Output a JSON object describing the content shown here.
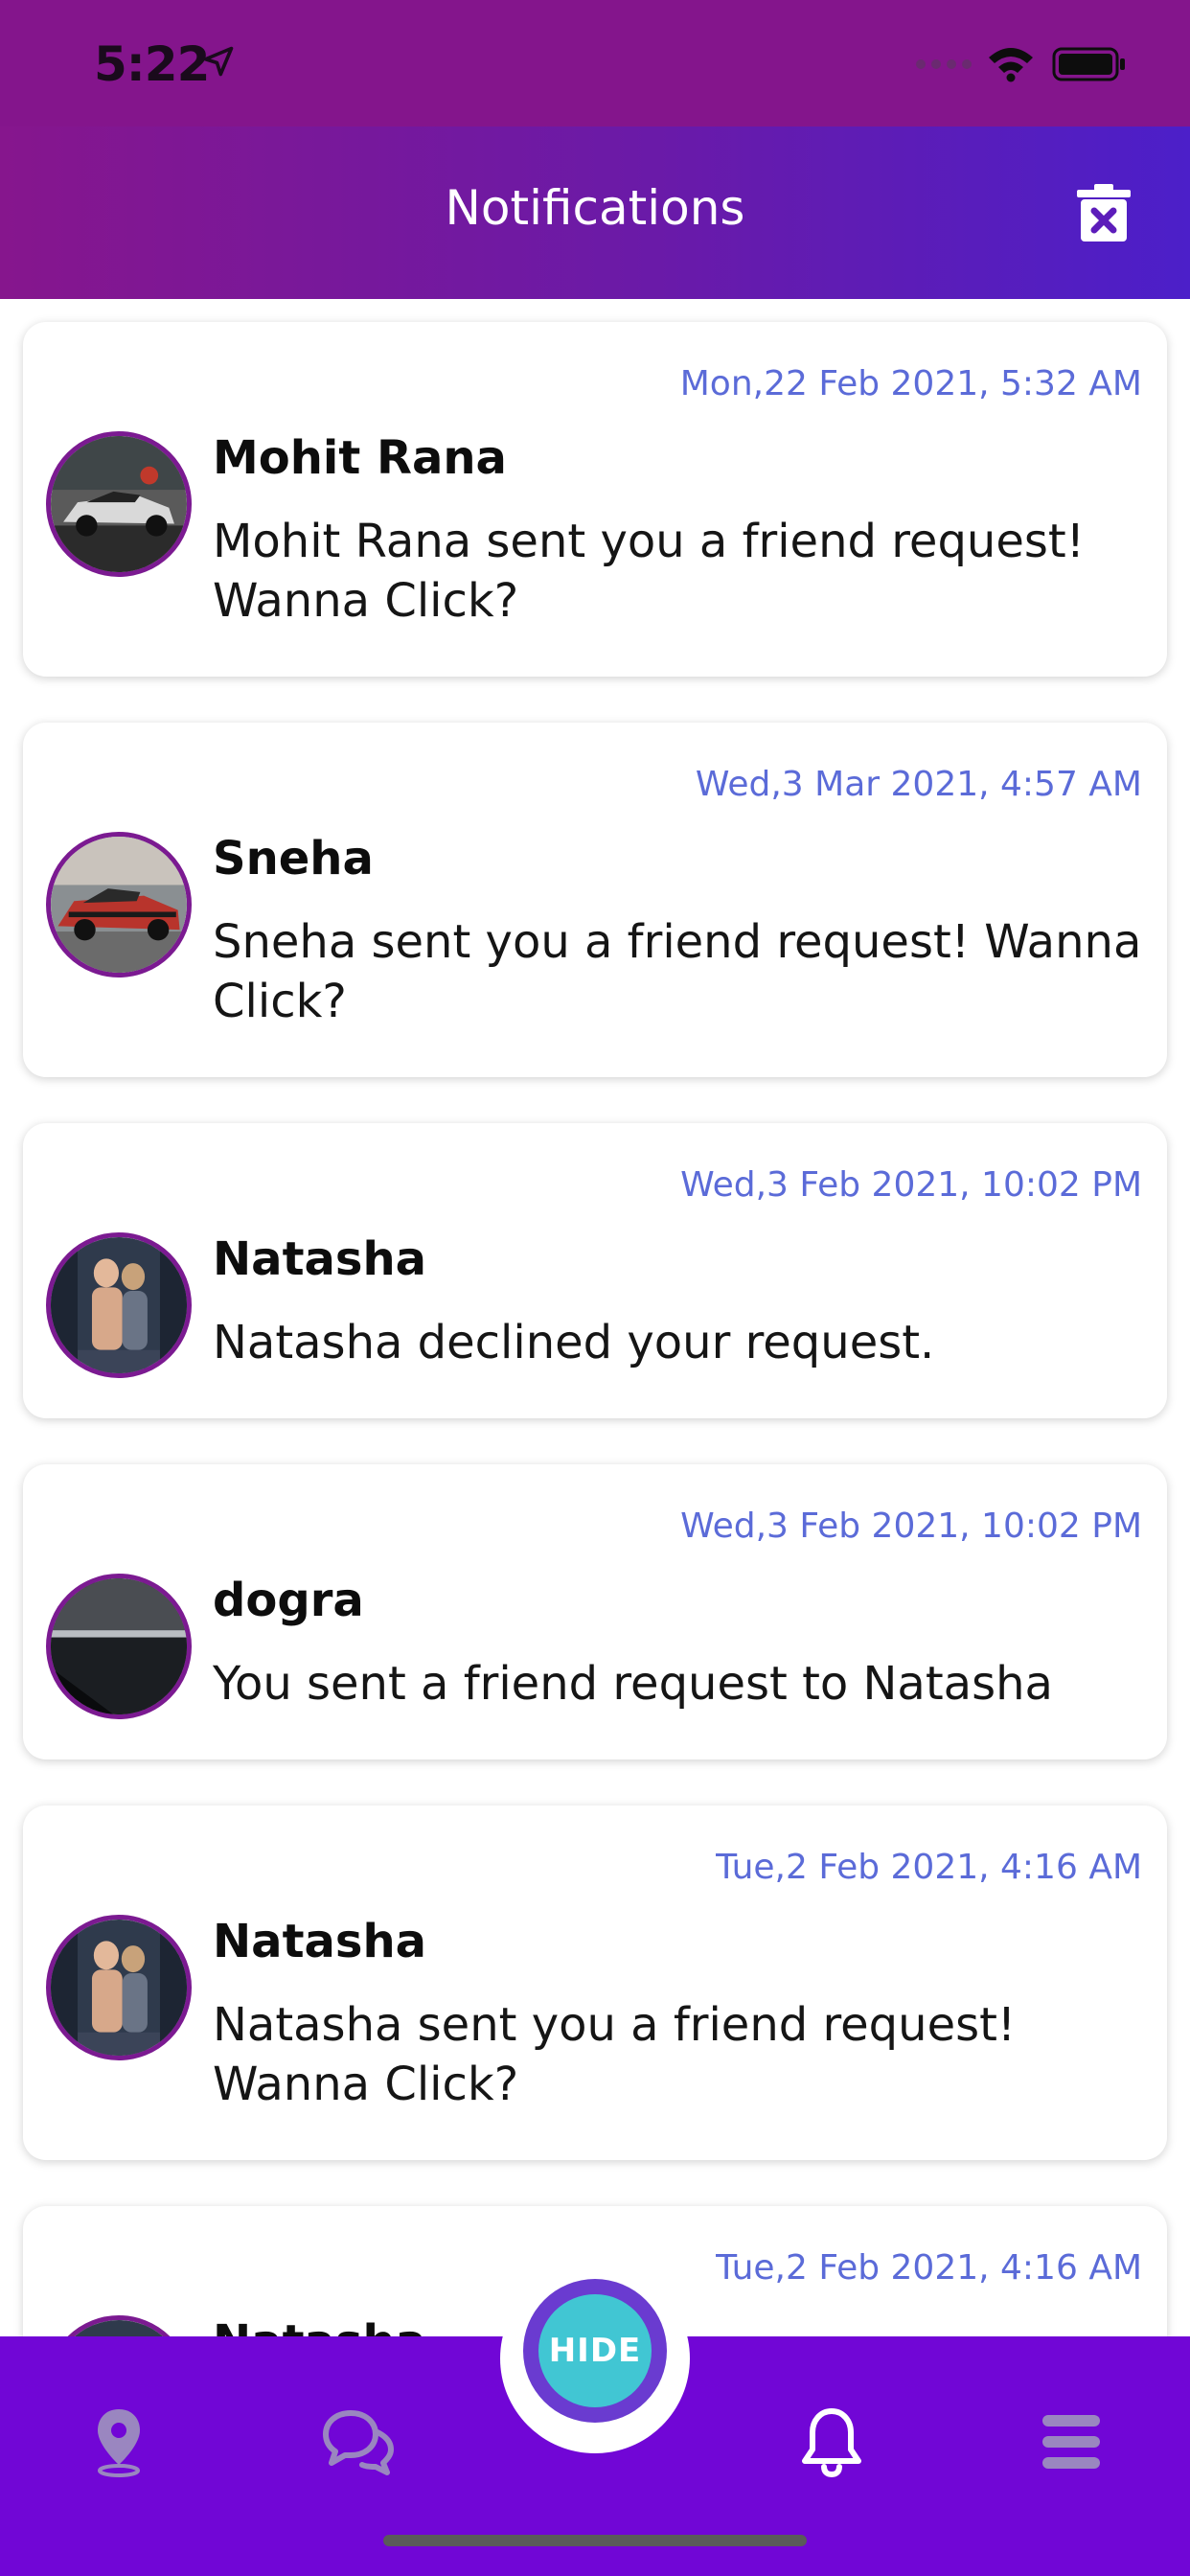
{
  "status_bar": {
    "time": "5:22"
  },
  "header": {
    "title": "Notifications",
    "clear_icon": "trash-x-icon"
  },
  "notifications": [
    {
      "date": "Mon,22 Feb 2021, 5:32 AM",
      "name": "Mohit Rana",
      "message": "Mohit Rana sent you a friend request! Wanna Click?",
      "avatar": "car-photo-avatar"
    },
    {
      "date": "Wed,3 Mar 2021, 4:57 AM",
      "name": "Sneha",
      "message": "Sneha sent you a friend request! Wanna Click?",
      "avatar": "red-car-avatar"
    },
    {
      "date": "Wed,3 Feb 2021, 10:02 PM",
      "name": "Natasha",
      "message": "Natasha declined your request.",
      "avatar": "gym-couple-avatar"
    },
    {
      "date": "Wed,3 Feb 2021, 10:02 PM",
      "name": "dogra",
      "message": "You sent a friend request to Natasha",
      "avatar": "night-lake-avatar"
    },
    {
      "date": "Tue,2 Feb 2021, 4:16 AM",
      "name": "Natasha",
      "message": "Natasha sent you a friend request! Wanna Click?",
      "avatar": "gym-couple-avatar"
    },
    {
      "date": "Tue,2 Feb 2021, 4:16 AM",
      "name": "Natasha",
      "message": "",
      "avatar": "gym-couple-avatar"
    }
  ],
  "bottom_nav": {
    "items": [
      {
        "icon": "map-pin-icon",
        "active": false
      },
      {
        "icon": "chat-bubbles-icon",
        "active": false
      },
      {
        "icon": "bell-icon",
        "active": true
      },
      {
        "icon": "menu-icon",
        "active": false
      }
    ],
    "center_button_label": "HIDE"
  },
  "colors": {
    "status_bar": "#84158c",
    "header_start": "#86168d",
    "header_end": "#4c1fc9",
    "date_text": "#5b6bd8",
    "avatar_border": "#7b1a91",
    "nav_bg": "#7106d6",
    "hide_button": "#41c6d3"
  }
}
